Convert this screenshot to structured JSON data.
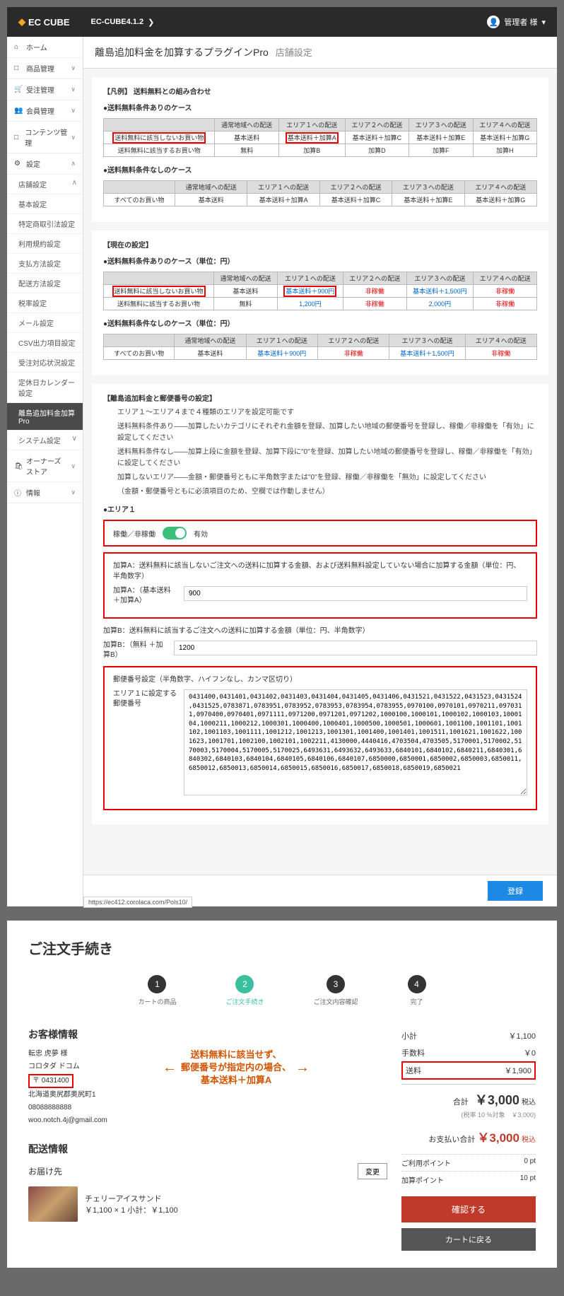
{
  "topbar": {
    "logo_text": "EC CUBE",
    "version": "EC-CUBE4.1.2",
    "user_label": "管理者 様"
  },
  "sidebar": {
    "items": [
      {
        "icon": "⌂",
        "label": "ホーム"
      },
      {
        "icon": "□",
        "label": "商品管理",
        "exp": "∨"
      },
      {
        "icon": "🛒",
        "label": "受注管理",
        "exp": "∨"
      },
      {
        "icon": "👥",
        "label": "会員管理",
        "exp": "∨"
      },
      {
        "icon": "□",
        "label": "コンテンツ管理",
        "exp": "∨"
      },
      {
        "icon": "⚙",
        "label": "設定",
        "exp": "∧"
      }
    ],
    "sub1_label": "店舗設定",
    "sub1_exp": "∧",
    "settings_sub": [
      "基本設定",
      "特定商取引法設定",
      "利用規約設定",
      "支払方法設定",
      "配送方法設定",
      "税率設定",
      "メール設定",
      "CSV出力項目設定",
      "受注対応状況設定",
      "定休日カレンダー設定",
      "離島追加料金加算Pro"
    ],
    "system_label": "システム設定",
    "system_exp": "∨",
    "owners_label": "オーナーズストア",
    "owners_icon": "🛍",
    "owners_exp": "∨",
    "info_label": "情報",
    "info_icon": "ⓘ",
    "info_exp": "∨"
  },
  "page": {
    "title": "離島追加料金を加算するプラグインPro",
    "title_sub": "店舗設定",
    "section1_title": "【凡例】 送料無料との組み合わせ",
    "case1_title": "●送料無料条件ありのケース",
    "case2_title": "●送料無料条件なしのケース",
    "current_title": "【現在の設定】",
    "current_case1": "●送料無料条件ありのケース（単位：円）",
    "current_case2": "●送料無料条件なしのケース（単位：円）",
    "ex_table1": {
      "headers": [
        "",
        "通常地域への配送",
        "エリア１への配送",
        "エリア２への配送",
        "エリア３への配送",
        "エリア４への配送"
      ],
      "rows": [
        [
          "送料無料に該当しないお買い物",
          "基本送料",
          "基本送料＋加算A",
          "基本送料＋加算C",
          "基本送料＋加算E",
          "基本送料＋加算G"
        ],
        [
          "送料無料に該当するお買い物",
          "無料",
          "加算B",
          "加算D",
          "加算F",
          "加算H"
        ]
      ]
    },
    "ex_table2": {
      "headers": [
        "",
        "通常地域への配送",
        "エリア１への配送",
        "エリア２への配送",
        "エリア３への配送",
        "エリア４への配送"
      ],
      "rows": [
        [
          "すべてのお買い物",
          "基本送料",
          "基本送料＋加算A",
          "基本送料＋加算C",
          "基本送料＋加算E",
          "基本送料＋加算G"
        ]
      ]
    },
    "cur_table1": {
      "headers": [
        "",
        "通常地域への配送",
        "エリア１への配送",
        "エリア２への配送",
        "エリア３への配送",
        "エリア４への配送"
      ],
      "rows": [
        [
          "送料無料に該当しないお買い物",
          "基本送料",
          "基本送料＋900円",
          "非稼働",
          "基本送料＋1,500円",
          "非稼働"
        ],
        [
          "送料無料に該当するお買い物",
          "無料",
          "1,200円",
          "非稼働",
          "2,000円",
          "非稼働"
        ]
      ]
    },
    "cur_table2": {
      "headers": [
        "",
        "通常地域への配送",
        "エリア１への配送",
        "エリア２への配送",
        "エリア３への配送",
        "エリア４への配送"
      ],
      "rows": [
        [
          "すべてのお買い物",
          "基本送料",
          "基本送料＋900円",
          "非稼働",
          "基本送料＋1,500円",
          "非稼働"
        ]
      ]
    },
    "postal_section_title": "【離島追加料金と郵便番号の設定】",
    "postal_note1": "エリア１～エリア４まで４種類のエリアを設定可能です",
    "postal_note2": "送料無料条件あり――加算したいカテゴリにそれぞれ金額を登録、加算したい地域の郵便番号を登録し、稼働／非稼働を「有効」に設定してください",
    "postal_note3": "送料無料条件なし――加算上段に金額を登録、加算下段に\"0\"を登録、加算したい地域の郵便番号を登録し、稼働／非稼働を「有効」に設定してください",
    "postal_note4": "加算しないエリア――金額・郵便番号ともに半角数字または\"0\"を登録、稼働／非稼働を「無効」に設定してください",
    "postal_note5": "（金額・郵便番号ともに必須項目のため、空欄では作動しません）",
    "area1_label": "●エリア１",
    "toggle_label": "稼働／非稼働",
    "toggle_value": "有効",
    "addA_desc": "加算A：送料無料に該当しないご注文への送料に加算する金額、および送料無料設定していない場合に加算する金額（単位：円、半角数字）",
    "addA_label": "加算A：（基本送料＋加算A）",
    "addA_value": "900",
    "addB_desc": "加算B：送料無料に該当するご注文への送料に加算する金額（単位：円、半角数字）",
    "addB_label": "加算B：（無料 ＋加算B）",
    "addB_value": "1200",
    "zip_section": "郵便番号設定（半角数字、ハイフンなし、カンマ区切り）",
    "zip_label": "エリア１に設定する郵便番号",
    "zip_value": "0431400,0431401,0431402,0431403,0431404,0431405,0431406,0431521,0431522,0431523,0431524,0431525,0783871,0783951,0783952,0783953,0783954,0783955,0970100,0970101,0970211,0970311,0970400,0970401,0971111,0971200,0971201,0971202,1000100,1000101,1000102,1000103,1000104,1000211,1000212,1000301,1000400,1000401,1000500,1000501,1000601,1001100,1001101,1001102,1001103,1001111,1001212,1001213,1001301,1001400,1001401,1001511,1001621,1001622,1001623,1001701,1002100,1002101,1002211,4130000,4440416,4703504,4703505,5170001,5170002,5170003,5170004,5170005,5170025,6493631,6493632,6493633,6840101,6840102,6840211,6840301,6840302,6840103,6840104,6840105,6840106,6840107,6850000,6850001,6850002,6850003,6850011,6850012,6850013,6850014,6850015,6850016,6850017,6850018,6850019,6850021",
    "submit_label": "登録",
    "url_hint": "https://ec412.corolaca.com/Pols10/"
  },
  "checkout": {
    "title": "ご注文手続き",
    "steps": [
      {
        "n": "1",
        "label": "カートの商品"
      },
      {
        "n": "2",
        "label": "ご注文手続き"
      },
      {
        "n": "3",
        "label": "ご注文内容確認"
      },
      {
        "n": "4",
        "label": "完了"
      }
    ],
    "cust_title": "お客様情報",
    "cust_name": "転忠 虎夢 様",
    "cust_company": "コロタダ ドコム",
    "cust_zip": "〒 0431400",
    "cust_addr": "北海道奥尻郡奥尻町1",
    "cust_tel": "08088888888",
    "cust_email": "woo.notch.4j@gmail.com",
    "callout_l1": "送料無料に該当せず、",
    "callout_l2": "郵便番号が指定内の場合、",
    "callout_l3": "基本送料＋加算A",
    "deliver_title": "配送情報",
    "deliver_dest": "お届け先",
    "change_btn": "変更",
    "product_name": "チェリーアイスサンド",
    "product_price_line": "￥1,100 × 1  小計：￥1,100",
    "summary": {
      "subtotal_label": "小計",
      "subtotal": "￥1,100",
      "fee_label": "手数料",
      "fee": "￥0",
      "shipping_label": "送料",
      "shipping": "￥1,900",
      "total_label": "合計",
      "total": "￥3,000",
      "total_suffix": "税込",
      "tax_note": "(税率 10 %対象　￥3,000)",
      "pay_label": "お支払い合計",
      "pay_amount": "￥3,000",
      "pay_suffix": "税込",
      "use_pt_label": "ご利用ポイント",
      "use_pt": "0 pt",
      "add_pt_label": "加算ポイント",
      "add_pt": "10 pt"
    },
    "btn_confirm": "確認する",
    "btn_back": "カートに戻る"
  }
}
